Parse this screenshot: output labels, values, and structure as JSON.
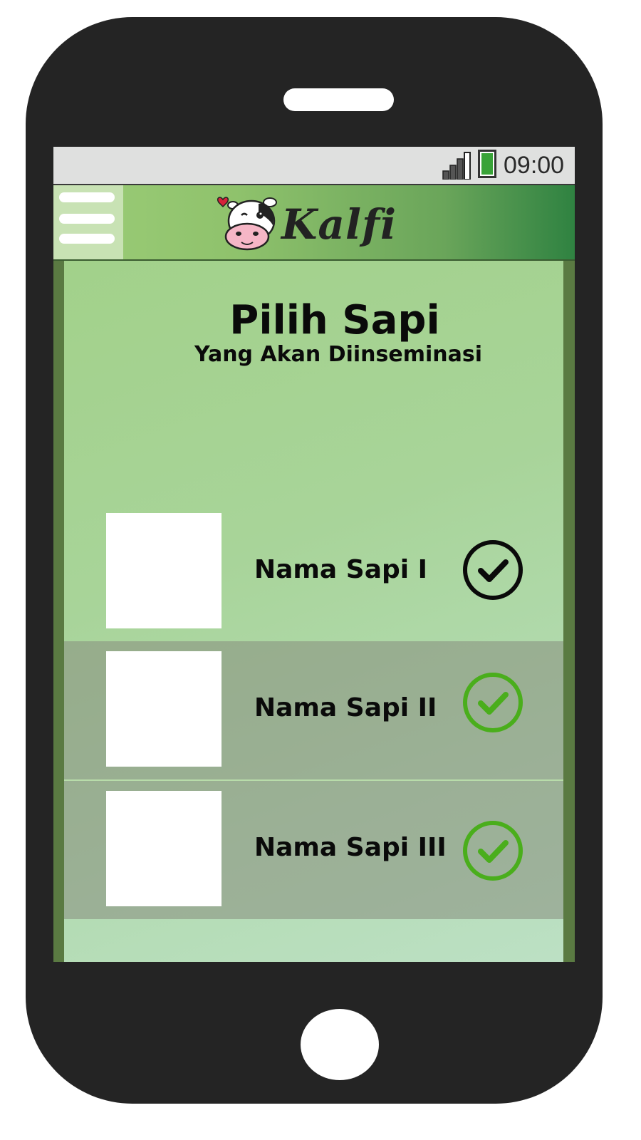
{
  "status_bar": {
    "time": "09:00",
    "signal_icon": "signal-bars-icon",
    "battery_icon": "battery-icon",
    "battery_color": "#39a338"
  },
  "app_bar": {
    "menu_icon": "hamburger-menu-icon",
    "logo_text": "Kalfi",
    "logo_icon": "cow-head-icon",
    "gradient_start": "#9ccd78",
    "gradient_end": "#2f8241"
  },
  "page": {
    "title": "Pilih Sapi",
    "subtitle": "Yang Akan Diinseminasi"
  },
  "cows": [
    {
      "name": "Nama Sapi I",
      "selected": false,
      "check_color": "#0a0a0a",
      "check_icon": "check-circle-icon"
    },
    {
      "name": "Nama Sapi II",
      "selected": true,
      "check_color": "#4aae1c",
      "check_icon": "check-circle-icon"
    },
    {
      "name": "Nama Sapi III",
      "selected": true,
      "check_color": "#4aae1c",
      "check_icon": "check-circle-icon"
    }
  ]
}
